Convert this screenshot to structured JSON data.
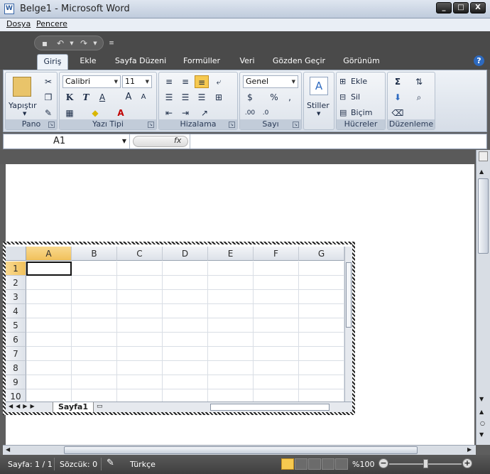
{
  "window": {
    "title": "Belge1 - Microsoft Word",
    "doc_icon": "W",
    "min": "_",
    "max": "□",
    "close": "X"
  },
  "menu": {
    "file": "Dosya",
    "window": "Pencere"
  },
  "ribbon_tabs": [
    "Giriş",
    "Ekle",
    "Sayfa Düzeni",
    "Formüller",
    "Veri",
    "Gözden Geçir",
    "Görünüm"
  ],
  "active_tab": "Giriş",
  "groups": {
    "clipboard": {
      "label": "Pano",
      "paste": "Yapıştır"
    },
    "font": {
      "label": "Yazı Tipi",
      "font_name": "Calibri",
      "font_size": "11",
      "bold": "K",
      "italic": "T",
      "underline": "A"
    },
    "alignment": {
      "label": "Hizalama"
    },
    "number": {
      "label": "Sayı",
      "format": "Genel",
      "percent": "%"
    },
    "styles": {
      "label": "Stiller"
    },
    "cells": {
      "label": "Hücreler",
      "insert": "Ekle",
      "delete": "Sil",
      "format": "Biçim"
    },
    "editing": {
      "label": "Düzenleme"
    }
  },
  "formula_bar": {
    "name_box": "A1",
    "fx": "fx",
    "value": ""
  },
  "sheet": {
    "columns": [
      "A",
      "B",
      "C",
      "D",
      "E",
      "F",
      "G"
    ],
    "rows": [
      "1",
      "2",
      "3",
      "4",
      "5",
      "6",
      "7",
      "8",
      "9",
      "10"
    ],
    "active_cell": "A1",
    "tab_name": "Sayfa1"
  },
  "status": {
    "page": "Sayfa: 1 / 1",
    "words": "Sözcük: 0",
    "language": "Türkçe",
    "zoom": "%100",
    "zoom_out": "−",
    "zoom_in": "+"
  },
  "colors": {
    "accent": "#2d6ac0",
    "ribbon": "#dde3eb",
    "dark": "#4a4a4a"
  }
}
